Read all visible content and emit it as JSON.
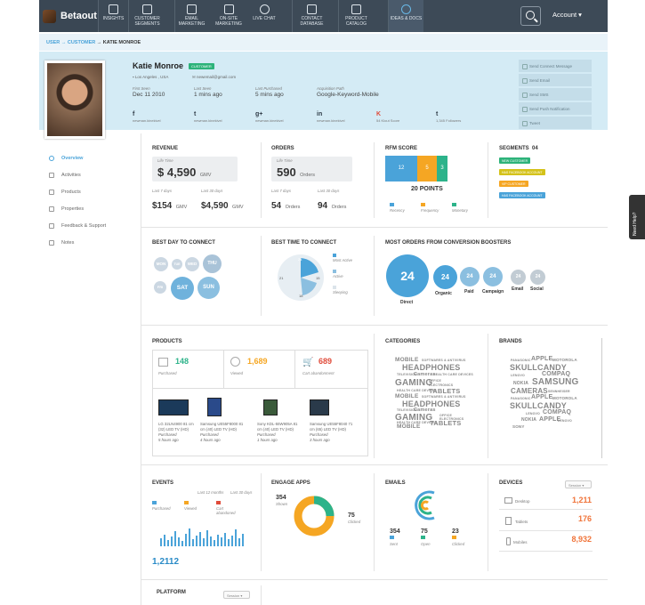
{
  "app": {
    "brand": "Betaout"
  },
  "nav": [
    {
      "label": "INSIGHTS"
    },
    {
      "label": "CUSTOMER SEGMENTS"
    },
    {
      "label": "EMAIL MARKETING"
    },
    {
      "label": "ON-SITE MARKETING"
    },
    {
      "label": "LIVE CHAT"
    },
    {
      "label": "CONTACT DATABASE"
    },
    {
      "label": "PRODUCT CATALOG"
    },
    {
      "label": "IDEAS & DOCS"
    }
  ],
  "account": "Account ▾",
  "breadcrumb": {
    "user": "USER",
    "arrow1": "→",
    "customer": "CUSTOMER",
    "arrow2": "→",
    "current": "KATIE MONROE"
  },
  "profile": {
    "name": "Katie Monroe",
    "tag": "CUSTOMER",
    "location": "Los Angeles , USA",
    "email": "newemail@gmail.com",
    "first_seen_label": "First Seen",
    "first_seen": "Dec 11 2010",
    "last_seen_label": "Last Seen",
    "last_seen": "1 mins ago",
    "last_purchased_label": "Last Purchased",
    "last_purchased": "5 mins ago",
    "acq_label": "Acquisition Path",
    "acq": "Google-Keyword-Mobile",
    "social": [
      {
        "icon": "f",
        "label": "newman.kinekivel"
      },
      {
        "icon": "t",
        "label": "newman.kinekivel"
      },
      {
        "icon": "g+",
        "label": "newman.kinekivel"
      },
      {
        "icon": "in",
        "label": "newman.kinekivel"
      },
      {
        "icon": "K",
        "label": "54 Klout Score"
      },
      {
        "icon": "t",
        "label": "1,345 Followers"
      }
    ]
  },
  "actions": [
    "Send Connect Message",
    "Send Email",
    "Send SMS",
    "Send Push Notification",
    "Tweet"
  ],
  "sidebar": [
    "Overview",
    "Activities",
    "Products",
    "Properties",
    "Feedback & Support",
    "Notes"
  ],
  "revenue": {
    "title": "REVENUE",
    "lifetime_label": "Life Time",
    "lifetime": "$ 4,590",
    "unit": "GMV",
    "l7_label": "Last 7 days",
    "l7": "$154",
    "l30_label": "Last 30 days",
    "l30": "$4,590"
  },
  "orders": {
    "title": "ORDERS",
    "lifetime_label": "Life Time",
    "lifetime": "590",
    "unit": "Orders",
    "l7_label": "Last 7 days",
    "l7": "54",
    "l30_label": "Last 30 days",
    "l30": "94"
  },
  "rfm": {
    "title": "RFM SCORE",
    "r": "12",
    "f": "5",
    "m": "3",
    "points": "20 POINTS",
    "legend": [
      "Recency",
      "Frequency",
      "Monetary"
    ]
  },
  "segments": {
    "title": "SEGMENTS",
    "count": "04",
    "items": [
      "NEW CUSTOMER",
      "HAS FACEBOOK ACCOUNT",
      "VIP CUSTOMER",
      "HAS FACEBOOK ACCOUNT"
    ]
  },
  "best_day": {
    "title": "BEST DAY TO CONNECT",
    "days": [
      "MON",
      "TUE",
      "WED",
      "THU",
      "FRI",
      "SAT",
      "SUN"
    ]
  },
  "best_time": {
    "title": "BEST TIME TO CONNECT",
    "ticks": [
      "24",
      "15",
      "18",
      "21"
    ],
    "legend": [
      "Most Active",
      "Active",
      "Sleeping"
    ]
  },
  "boosters": {
    "title": "MOST ORDERS FROM CONVERSION BOOSTERS",
    "items": [
      {
        "v": "24",
        "l": "Direct"
      },
      {
        "v": "24",
        "l": "Organic"
      },
      {
        "v": "24",
        "l": "Paid"
      },
      {
        "v": "24",
        "l": "Campaign"
      },
      {
        "v": "24",
        "l": "Email"
      },
      {
        "v": "24",
        "l": "Social"
      }
    ]
  },
  "products": {
    "title": "PRODUCTS",
    "purchased": "148",
    "purchased_l": "Purchased",
    "viewed": "1,689",
    "viewed_l": "Viewed",
    "cart": "689",
    "cart_l": "Cart abandonment",
    "items": [
      {
        "name": "LG 32LN4900 81 cm (32) LED TV (HD)",
        "status": "Purchased",
        "time": "5 hours ago"
      },
      {
        "name": "Samsung UE55F8000 81 cm (40) LED TV (HD)",
        "status": "Purchased",
        "time": "4 hours ago"
      },
      {
        "name": "Sony KDL-55W905A 81 cm (40) LED TV (HD)",
        "status": "Purchased",
        "time": "1 hours ago"
      },
      {
        "name": "Samsung UE55F8040 71 cm (65) LED TV (HD)",
        "status": "Purchased",
        "time": "3 hours ago"
      }
    ]
  },
  "categories": {
    "title": "CATEGORIES"
  },
  "brands": {
    "title": "BRANDS"
  },
  "events": {
    "title": "EVENTS",
    "l12": "Last 12 months",
    "l30": "Last 30 days",
    "legend": [
      "Purchased",
      "Viewed",
      "Cart abandoned"
    ],
    "total": "1,2112"
  },
  "engage": {
    "title": "ENGAGE APPS",
    "shown": "354",
    "shown_l": "Shown",
    "clicked": "75",
    "clicked_l": "Clicked"
  },
  "emails": {
    "title": "EMAILS",
    "sent": "354",
    "sent_l": "Sent",
    "open": "75",
    "open_l": "Open",
    "clicked": "23",
    "clicked_l": "Clicked"
  },
  "devices": {
    "title": "DEVICES",
    "select": "Session ▾",
    "items": [
      {
        "l": "Desktop",
        "v": "1,211"
      },
      {
        "l": "Tablets",
        "v": "176"
      },
      {
        "l": "Mobiles",
        "v": "8,932"
      }
    ]
  },
  "platform": {
    "title": "PLATFORM",
    "select": "Session ▾"
  },
  "feedback": "Need Help?"
}
